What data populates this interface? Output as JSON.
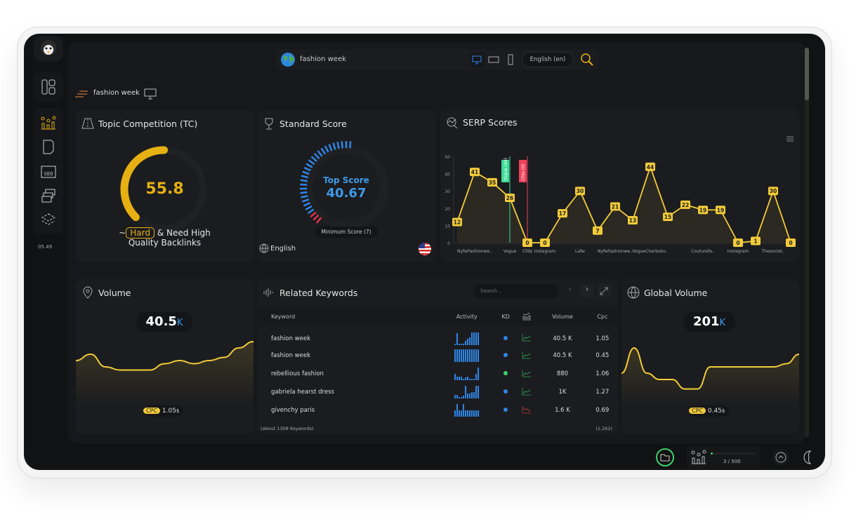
{
  "app": {
    "version": "05.49"
  },
  "topbar": {
    "query": "fashion week",
    "language": "English (en)",
    "devices": [
      "desktop-icon",
      "tablet-icon",
      "mobile-icon"
    ]
  },
  "breadcrumb": {
    "title": "fashion week"
  },
  "tc": {
    "title": "Topic Competition (TC)",
    "value": "55.8",
    "percent": 55.8,
    "prefix": "~",
    "level": "Hard",
    "desc1": "& Need High",
    "desc2": "Quality Backlinks",
    "color": "#e6b012"
  },
  "standard": {
    "title": "Standard Score",
    "label": "Top Score",
    "value": "40.67",
    "min_label": "Minimum Score (7)",
    "language": "English"
  },
  "serp": {
    "title": "SERP Scores"
  },
  "volume": {
    "title": "Volume",
    "value": "40.5",
    "unit": "K",
    "cpc_label": "CPC",
    "cpc": "1.05",
    "cpc_unit": "$",
    "trend": [
      6,
      7,
      5,
      4.5,
      4.5,
      4.5,
      5.5,
      6,
      5.5,
      6,
      6.5,
      8,
      9
    ]
  },
  "global": {
    "title": "Global Volume",
    "value": "201",
    "unit": "K",
    "cpc_label": "CPC",
    "cpc": "0.45",
    "cpc_unit": "$",
    "trend": [
      4,
      8,
      4,
      3,
      3,
      1.5,
      1.5,
      5,
      5,
      5,
      5,
      5,
      5,
      5.5,
      7
    ]
  },
  "related": {
    "title": "Related Keywords",
    "search_placeholder": "Search ..",
    "columns": [
      "Keyword",
      "Activity",
      "KD",
      "",
      "Volume",
      "Cpc"
    ],
    "rows": [
      {
        "keyword": "fashion week",
        "activity": [
          1,
          9,
          1,
          1,
          1,
          3,
          5,
          6,
          10,
          10,
          10,
          10
        ],
        "kd_color": "#2f86e8",
        "trend": "up",
        "volume": "40.5 K",
        "cpc": "1.05"
      },
      {
        "keyword": "fashion week",
        "activity": [
          10,
          10,
          10,
          10,
          10,
          10,
          10,
          10,
          10,
          10,
          10,
          10
        ],
        "kd_color": "#2f86e8",
        "trend": "up",
        "volume": "40.5 K",
        "cpc": "0.45"
      },
      {
        "keyword": "rebellious fashion",
        "activity": [
          5,
          3,
          3,
          3,
          1,
          2,
          3,
          1,
          1,
          1,
          5,
          10
        ],
        "kd_color": "#3ccf6a",
        "trend": "up",
        "volume": "880",
        "cpc": "1.06"
      },
      {
        "keyword": "gabriela hearst dress",
        "activity": [
          3,
          3,
          1,
          1,
          2,
          10,
          4,
          4,
          5,
          5,
          10,
          10
        ],
        "kd_color": "#2f86e8",
        "trend": "up",
        "volume": "1K",
        "cpc": "1.27"
      },
      {
        "keyword": "givenchy paris",
        "activity": [
          5,
          10,
          5,
          5,
          10,
          5,
          5,
          5,
          5,
          5,
          5,
          5
        ],
        "kd_color": "#2f86e8",
        "trend": "down",
        "volume": "1.6 K",
        "cpc": "0.69"
      }
    ],
    "footer_left": "(about 1308 Keywords)",
    "footer_right": "(1.262)"
  },
  "bottom": {
    "progress_text": "3 / 500",
    "progress": 0.006
  },
  "chart_data": {
    "type": "line",
    "title": "SERP Scores",
    "ylim": [
      0,
      50
    ],
    "yticks": [
      0,
      10,
      20,
      30,
      40,
      50
    ],
    "categories": [
      "",
      "NyfwFashionwe..",
      "",
      "Vogue",
      "Cfda",
      "Instagram",
      "",
      "Lafw",
      "",
      "NyfwFashionwe..",
      "",
      "VogueCharlesto..",
      "",
      "",
      "Couturefa..",
      "",
      "Instagram",
      "",
      "Thesociet..",
      ""
    ],
    "values": [
      12,
      41,
      35,
      26,
      0,
      0,
      17,
      30,
      7,
      21,
      13,
      44,
      15,
      22,
      19,
      19,
      0,
      1,
      30,
      0
    ],
    "annotations": [
      {
        "index": 3,
        "label": "Vogue (44)",
        "color": "#3ddc97"
      },
      {
        "index": 4,
        "label": "Cfda (0)",
        "color": "#f0405a"
      }
    ],
    "line_color": "#f2cb3a",
    "grid": false
  }
}
